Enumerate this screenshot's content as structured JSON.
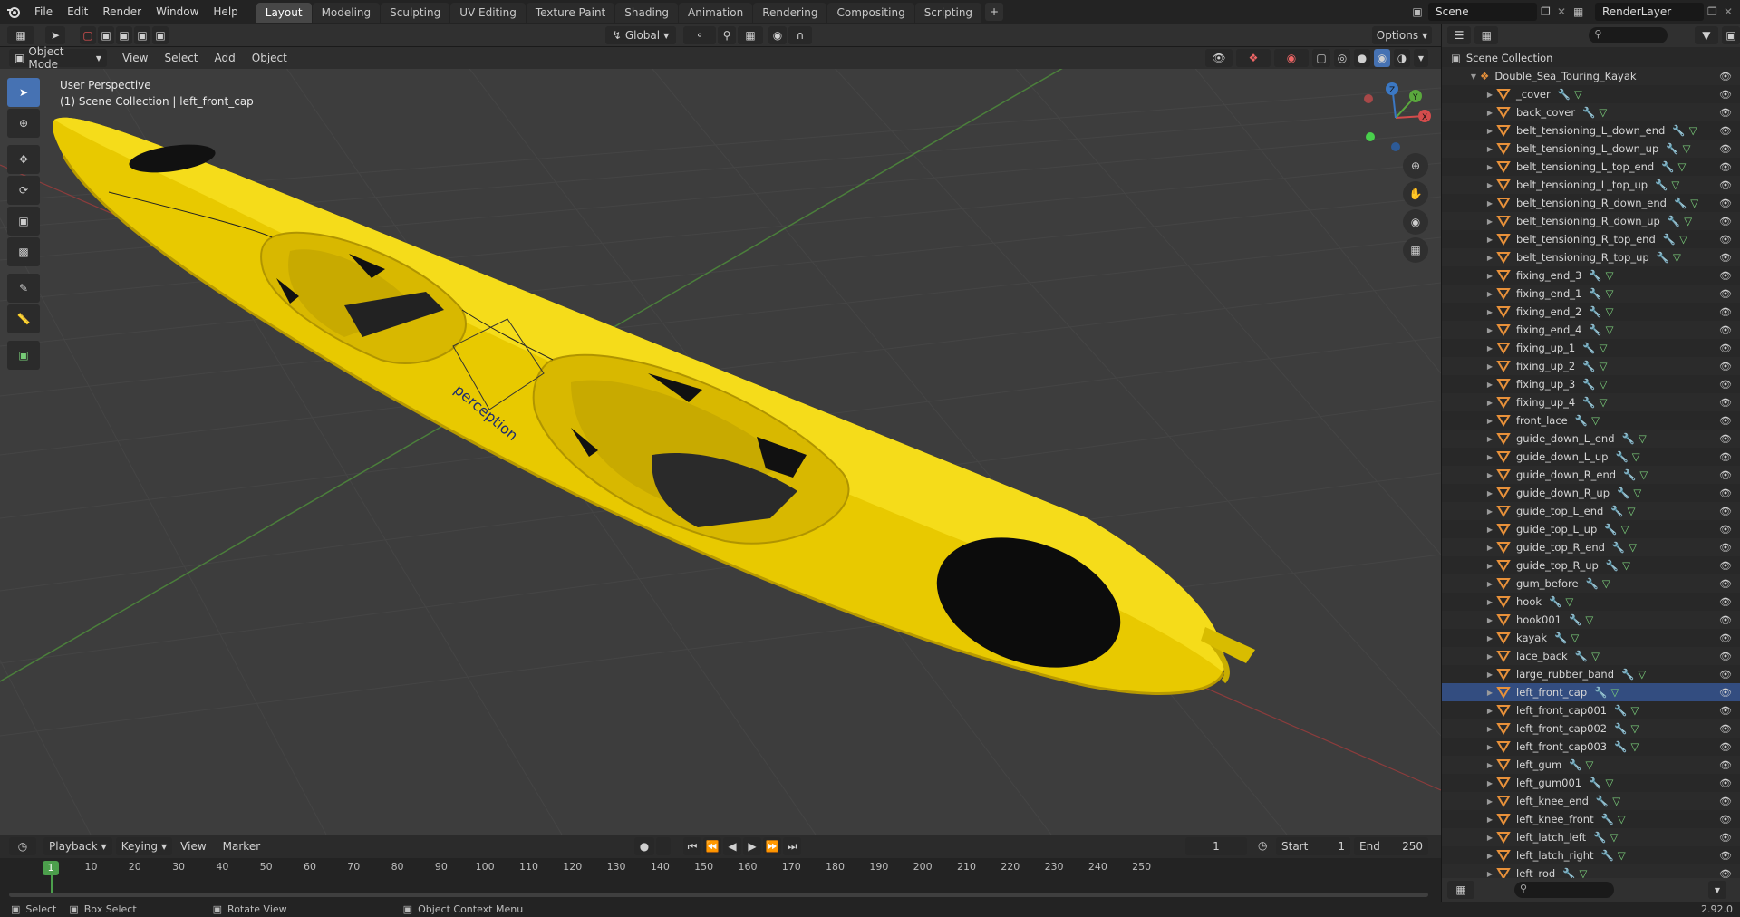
{
  "app": {
    "menus": [
      "File",
      "Edit",
      "Render",
      "Window",
      "Help"
    ],
    "workspaces": [
      "Layout",
      "Modeling",
      "Sculpting",
      "UV Editing",
      "Texture Paint",
      "Shading",
      "Animation",
      "Rendering",
      "Compositing",
      "Scripting"
    ],
    "active_workspace": "Layout",
    "scene": "Scene",
    "render_layer": "RenderLayer"
  },
  "viewport_header": {
    "mode": "Object Mode",
    "menus": [
      "View",
      "Select",
      "Add",
      "Object"
    ],
    "orientation": "Global",
    "options": "Options"
  },
  "viewport": {
    "perspective": "User Perspective",
    "context": "(1) Scene Collection | left_front_cap",
    "logo_text": "perception",
    "axis_labels": {
      "x": "X",
      "y": "Y",
      "z": "Z"
    }
  },
  "timeline": {
    "menus": [
      "Playback",
      "Keying",
      "View",
      "Marker"
    ],
    "current_frame": "1",
    "start_label": "Start",
    "start": "1",
    "end_label": "End",
    "end": "250",
    "ticks": [
      "1",
      "10",
      "20",
      "30",
      "40",
      "50",
      "60",
      "70",
      "80",
      "90",
      "100",
      "110",
      "120",
      "130",
      "140",
      "150",
      "160",
      "170",
      "180",
      "190",
      "200",
      "210",
      "220",
      "230",
      "240",
      "250"
    ]
  },
  "statusbar": {
    "select": "Select",
    "box_select": "Box Select",
    "rotate": "Rotate View",
    "context_menu": "Object Context Menu",
    "version": "2.92.0"
  },
  "outliner": {
    "root": "Scene Collection",
    "collection": "Double_Sea_Touring_Kayak",
    "selected": "left_front_cap",
    "items": [
      "_cover",
      "back_cover",
      "belt_tensioning_L_down_end",
      "belt_tensioning_L_down_up",
      "belt_tensioning_L_top_end",
      "belt_tensioning_L_top_up",
      "belt_tensioning_R_down_end",
      "belt_tensioning_R_down_up",
      "belt_tensioning_R_top_end",
      "belt_tensioning_R_top_up",
      "fixing_end_3",
      "fixing_end_1",
      "fixing_end_2",
      "fixing_end_4",
      "fixing_up_1",
      "fixing_up_2",
      "fixing_up_3",
      "fixing_up_4",
      "front_lace",
      "guide_down_L_end",
      "guide_down_L_up",
      "guide_down_R_end",
      "guide_down_R_up",
      "guide_top_L_end",
      "guide_top_L_up",
      "guide_top_R_end",
      "guide_top_R_up",
      "gum_before",
      "hook",
      "hook001",
      "kayak",
      "lace_back",
      "large_rubber_band",
      "left_front_cap",
      "left_front_cap001",
      "left_front_cap002",
      "left_front_cap003",
      "left_gum",
      "left_gum001",
      "left_knee_end",
      "left_knee_front",
      "left_latch_left",
      "left_latch_right",
      "left_rod"
    ]
  },
  "colors": {
    "accent": "#4672b3",
    "kayak": "#f2d40a",
    "object_icon": "#e8913a"
  }
}
